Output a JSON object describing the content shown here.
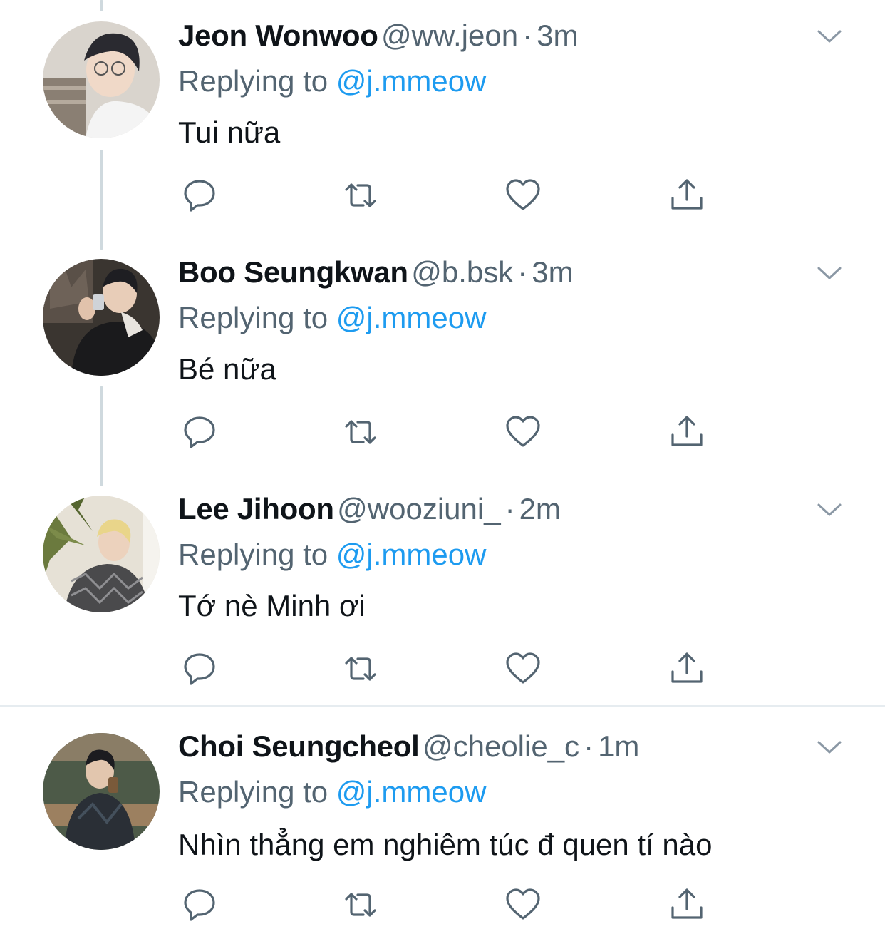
{
  "colors": {
    "name": "#0f1419",
    "secondary": "#536471",
    "mention": "#1d9bf0",
    "thread_line": "#cfd9de",
    "divider": "#e6ecf0"
  },
  "replying_label": "Replying to",
  "tweets": [
    {
      "name": "Jeon Wonwoo",
      "handle": "@ww.jeon",
      "dot": "·",
      "time": "3m",
      "reply_to": "@j.mmeow",
      "text": "Tui nữa",
      "avatar_icon": "avatar-photo"
    },
    {
      "name": "Boo Seungkwan",
      "handle": "@b.bsk",
      "dot": "·",
      "time": "3m",
      "reply_to": "@j.mmeow",
      "text": "Bé nữa",
      "avatar_icon": "avatar-photo"
    },
    {
      "name": "Lee Jihoon",
      "handle": "@wooziuni_",
      "dot": "·",
      "time": "2m",
      "reply_to": "@j.mmeow",
      "text": "Tớ nè Minh ơi",
      "avatar_icon": "avatar-photo"
    },
    {
      "name": "Choi Seungcheol",
      "handle": "@cheolie_c",
      "dot": "·",
      "time": "1m",
      "reply_to": "@j.mmeow",
      "text": "Nhìn thẳng em nghiêm túc đ quen tí nào",
      "avatar_icon": "avatar-photo"
    }
  ],
  "icons": {
    "reply": "reply-icon",
    "retweet": "retweet-icon",
    "like": "heart-icon",
    "share": "share-icon",
    "more": "chevron-down-icon"
  }
}
